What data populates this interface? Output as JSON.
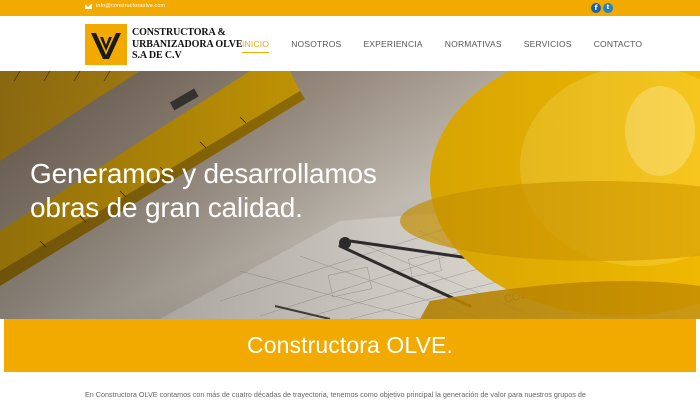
{
  "topbar": {
    "email": "info@constructoraolve.com",
    "social": [
      {
        "icon": "facebook-icon",
        "glyph": "f"
      },
      {
        "icon": "twitter-icon",
        "glyph": "t"
      }
    ]
  },
  "logo": {
    "line1": "CONSTRUCTORA &",
    "line2": "URBANIZADORA OLVE",
    "line3": "S.A DE C.V"
  },
  "nav": [
    {
      "label": "INICIO",
      "active": true
    },
    {
      "label": "NOSOTROS",
      "active": false
    },
    {
      "label": "EXPERIENCIA",
      "active": false
    },
    {
      "label": "NORMATIVAS",
      "active": false
    },
    {
      "label": "SERVICIOS",
      "active": false
    },
    {
      "label": "CONTACTO",
      "active": false
    }
  ],
  "hero": {
    "title_line1": "Generamos y desarrollamos",
    "title_line2": "obras de gran calidad."
  },
  "banner": {
    "title": "Constructora OLVE."
  },
  "intro": {
    "text": "En Constructora OLVE contamos con más de cuatro décadas de trayectoria, tenemos como objetivo principal la generación de valor para nuestros grupos de"
  },
  "colors": {
    "accent": "#f2a900",
    "facebook": "#1a61a8",
    "twitter": "#1c84c6"
  }
}
